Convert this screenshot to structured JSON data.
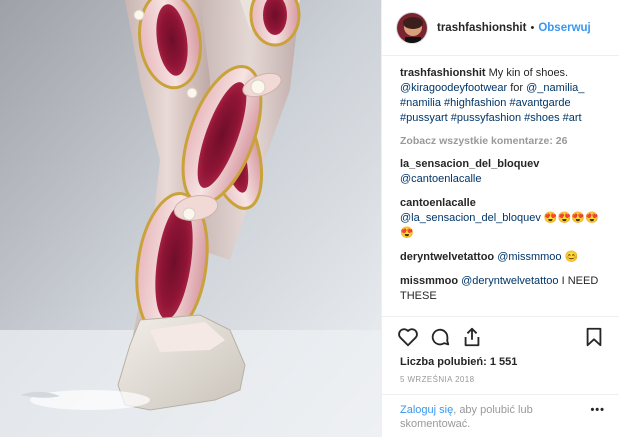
{
  "post": {
    "username": "trashfashionshit",
    "separator": "•",
    "follow_label": "Obserwuj",
    "caption": {
      "username": "trashfashionshit",
      "text": "My kin of shoes.",
      "mention1": "@kiragoodeyfootwear",
      "for": "for",
      "mention2": "@_namilia_",
      "hashtags": "#namilia #highfashion #avantgarde #pussyart #pussyfashion #shoes #art"
    },
    "view_all_comments": "Zobacz wszystkie komentarze: 26",
    "comments": [
      {
        "user": "la_sensacion_del_bloquev",
        "mention": "@cantoenlacalle",
        "text": ""
      },
      {
        "user": "cantoenlacalle",
        "mention": "@la_sensacion_del_bloquev",
        "text": "😍😍😍😍😍"
      },
      {
        "user": "deryntwelvetattoo",
        "mention": "@missmmoo",
        "text": "😊"
      },
      {
        "user": "missmmoo",
        "mention": "@deryntwelvetattoo",
        "text": "I NEED THESE"
      }
    ],
    "likes": "Liczba polubień: 1 551",
    "date": "5 WRZEŚNIA 2018",
    "login_link": "Zaloguj się",
    "login_rest": ", aby polubić lub skomentować.",
    "more_label": "•••",
    "icons": [
      "heart-icon",
      "comment-icon",
      "share-icon",
      "bookmark-icon"
    ],
    "colors": {
      "accent": "#3897f0",
      "text": "#262626",
      "muted": "#999999",
      "link": "#003569"
    }
  }
}
